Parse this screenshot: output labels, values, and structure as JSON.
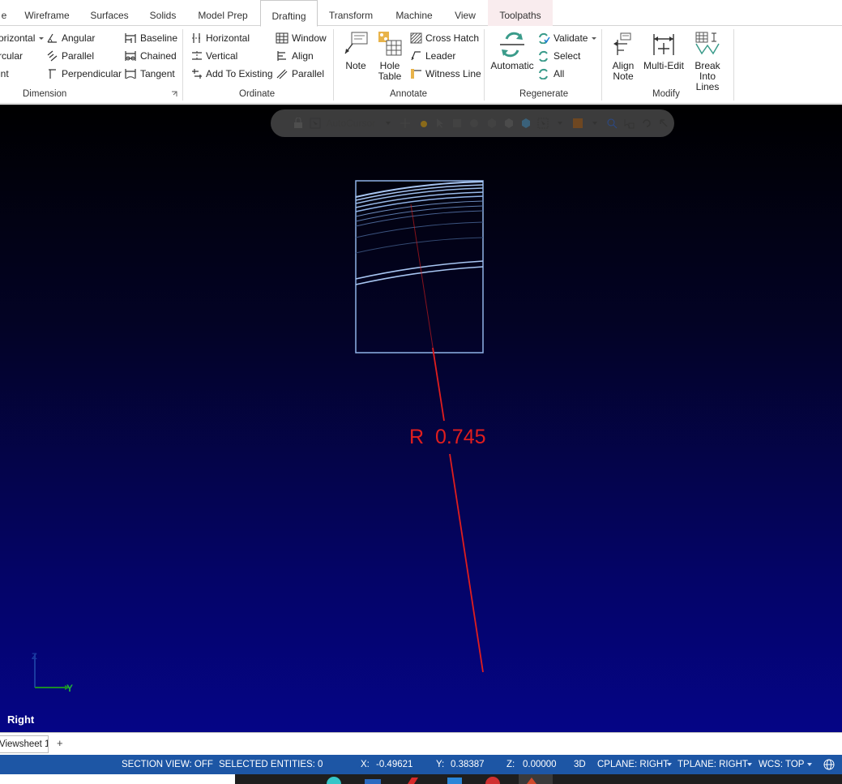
{
  "tabs": [
    {
      "label": "e"
    },
    {
      "label": "Wireframe"
    },
    {
      "label": "Surfaces"
    },
    {
      "label": "Solids"
    },
    {
      "label": "Model Prep"
    },
    {
      "label": "Drafting"
    },
    {
      "label": "Transform"
    },
    {
      "label": "Machine"
    },
    {
      "label": "View"
    },
    {
      "label": "Toolpaths"
    }
  ],
  "ribbon": {
    "dimension": {
      "label": "Dimension",
      "col1": [
        "orizontal",
        "rcular",
        "int"
      ],
      "col2": [
        "Angular",
        "Parallel",
        "Perpendicular"
      ],
      "col3": [
        "Baseline",
        "Chained",
        "Tangent"
      ]
    },
    "ordinate": {
      "label": "Ordinate",
      "col1": [
        "Horizontal",
        "Vertical",
        "Add To Existing"
      ],
      "col2": [
        "Window",
        "Align",
        "Parallel"
      ]
    },
    "annotate": {
      "label": "Annotate",
      "note": "Note",
      "hole_table_1": "Hole",
      "hole_table_2": "Table",
      "list": [
        "Cross Hatch",
        "Leader",
        "Witness Line"
      ]
    },
    "regenerate": {
      "label": "Regenerate",
      "automatic": "Automatic",
      "list": [
        "Validate",
        "Select",
        "All"
      ]
    },
    "modify": {
      "label": "Modify",
      "align_note_1": "Align",
      "align_note_2": "Note",
      "multi_edit": "Multi-Edit",
      "break_1": "Break",
      "break_2": "Into Lines"
    }
  },
  "toolbar": {
    "autocursor": "AutoCursor"
  },
  "viewport": {
    "dimension_text": "R  0.745",
    "view_name": "Right",
    "axis_y": "Y",
    "axis_z": "Z",
    "colors": {
      "dimension": "#e01e1e",
      "part": "#8fb3e6"
    }
  },
  "sheet": {
    "tab": "Viewsheet 1",
    "add": "+"
  },
  "status": {
    "section_view": "SECTION VIEW: OFF",
    "selected": "SELECTED ENTITIES: 0",
    "x_label": "X:",
    "x_val": "-0.49621",
    "y_label": "Y:",
    "y_val": "0.38387",
    "z_label": "Z:",
    "z_val": "0.00000",
    "mode": "3D",
    "cplane": "CPLANE: RIGHT",
    "tplane": "TPLANE: RIGHT",
    "wcs": "WCS: TOP"
  }
}
